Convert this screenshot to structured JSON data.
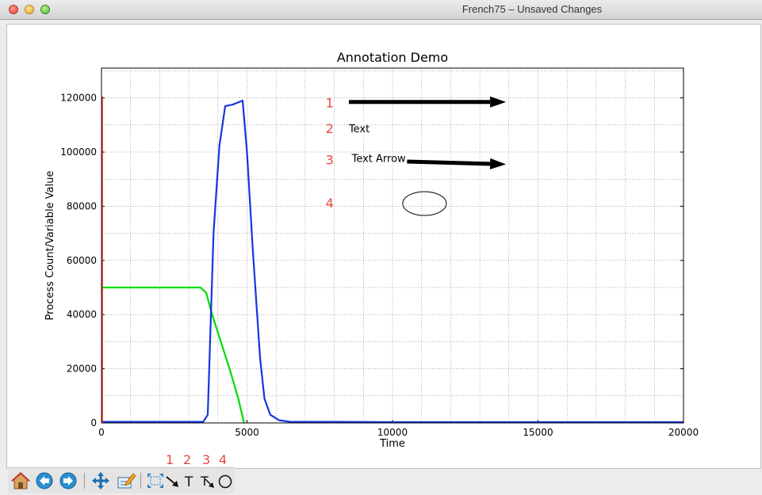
{
  "window": {
    "title": "French75 – Unsaved Changes"
  },
  "chart_data": {
    "type": "line",
    "title": "Annotation Demo",
    "xlabel": "Time",
    "ylabel": "Process Count/Variable Value",
    "xlim": [
      0,
      20000
    ],
    "ylim": [
      0,
      131000
    ],
    "xticks": [
      0,
      5000,
      10000,
      15000,
      20000
    ],
    "yticks": [
      0,
      20000,
      40000,
      60000,
      80000,
      100000,
      120000
    ],
    "xtick_labels": [
      "0",
      "5000",
      "10000",
      "15000",
      "20000"
    ],
    "ytick_labels": [
      "0",
      "20000",
      "40000",
      "60000",
      "80000",
      "100000",
      "120000"
    ],
    "grid": true,
    "series": [
      {
        "color": "#00dd00",
        "points": [
          [
            0,
            50000
          ],
          [
            3400,
            50000
          ],
          [
            3600,
            48000
          ],
          [
            3800,
            40000
          ],
          [
            4100,
            30000
          ],
          [
            4400,
            20000
          ],
          [
            4700,
            9000
          ],
          [
            4900,
            0
          ]
        ]
      },
      {
        "color": "#1535e0",
        "points": [
          [
            0,
            400
          ],
          [
            3500,
            400
          ],
          [
            3650,
            3000
          ],
          [
            3750,
            36000
          ],
          [
            3850,
            70000
          ],
          [
            4050,
            102000
          ],
          [
            4250,
            117000
          ],
          [
            4500,
            117500
          ],
          [
            4850,
            119000
          ],
          [
            5000,
            100000
          ],
          [
            5200,
            64000
          ],
          [
            5450,
            24000
          ],
          [
            5600,
            9000
          ],
          [
            5800,
            3000
          ],
          [
            6100,
            1000
          ],
          [
            6500,
            400
          ],
          [
            8000,
            400
          ],
          [
            10000,
            300
          ],
          [
            20000,
            300
          ]
        ]
      }
    ],
    "annotations": [
      {
        "label": "1",
        "kind": "arrow",
        "x": 7700,
        "y": 118000,
        "from": [
          8500,
          118500
        ],
        "to": [
          13900,
          118500
        ]
      },
      {
        "label": "2",
        "kind": "text",
        "x": 7700,
        "y": 108500,
        "text": "Text",
        "text_x": 8500,
        "text_y": 108500
      },
      {
        "label": "3",
        "kind": "text-arrow",
        "x": 7700,
        "y": 97000,
        "text": "Text Arrow",
        "text_x": 8600,
        "text_y": 97500,
        "from": [
          10500,
          96500
        ],
        "to": [
          13900,
          95500
        ]
      },
      {
        "label": "4",
        "kind": "ellipse",
        "x": 7700,
        "y": 81000,
        "cx": 11100,
        "cy": 81000,
        "rx": 750,
        "ry": 4400
      }
    ]
  },
  "toolbar": {
    "buttons": [
      {
        "name": "home-button",
        "icon": "home-icon"
      },
      {
        "name": "back-button",
        "icon": "back-arrow-icon"
      },
      {
        "name": "forward-button",
        "icon": "forward-arrow-icon"
      },
      {
        "name": "pan-button",
        "icon": "pan-icon"
      },
      {
        "name": "subplots-button",
        "icon": "edit-icon"
      },
      {
        "name": "zoom-button",
        "icon": "zoom-icon"
      },
      {
        "name": "arrow-tool-button",
        "icon": "arrow-tool-icon"
      },
      {
        "name": "text-tool-button",
        "icon": "text-tool-icon"
      },
      {
        "name": "text-arrow-tool-button",
        "icon": "text-arrow-tool-icon"
      },
      {
        "name": "ellipse-tool-button",
        "icon": "ellipse-tool-icon"
      }
    ],
    "tool_labels": [
      "1",
      "2",
      "3",
      "4"
    ]
  },
  "colors": {
    "annotation_label": "#e8463c",
    "axis_left_accent": "#cc2222"
  }
}
